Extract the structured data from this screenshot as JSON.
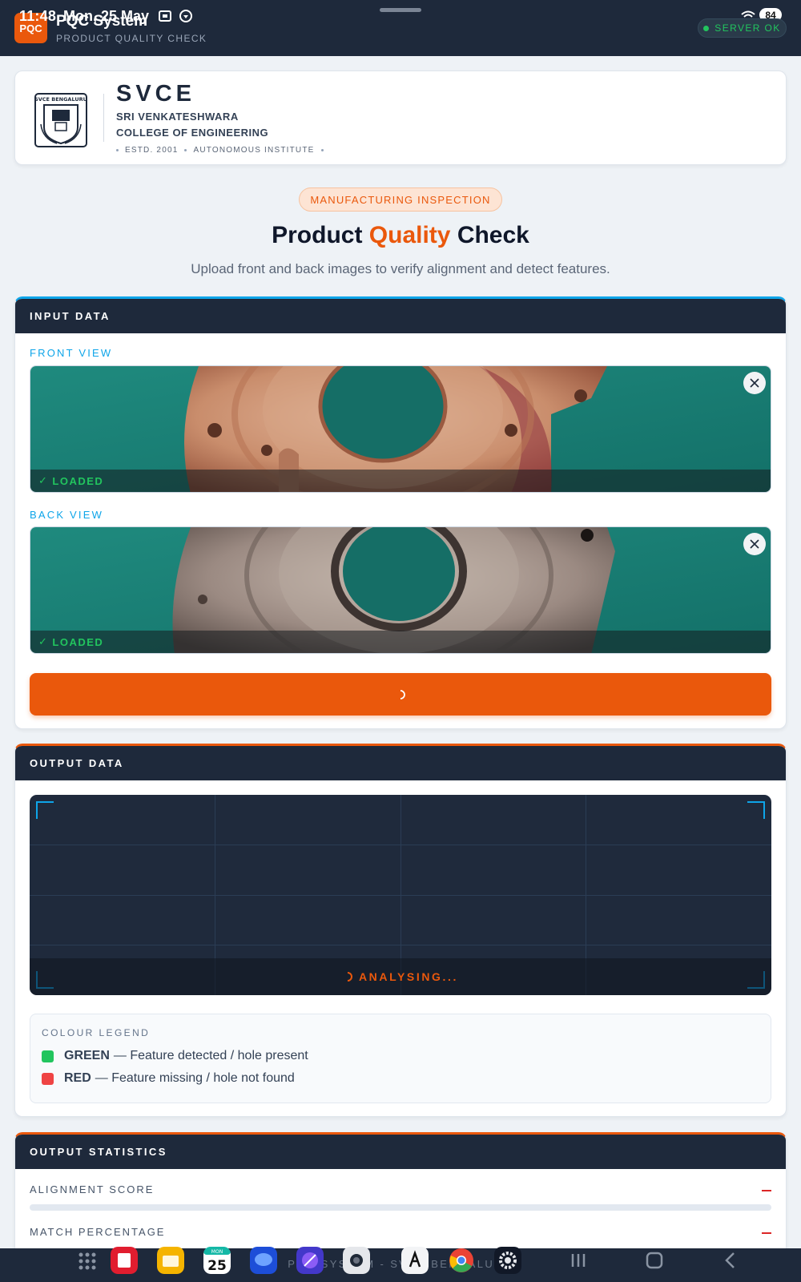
{
  "status_bar": {
    "time": "11:48",
    "date": "Mon, 25 May",
    "battery": "84"
  },
  "header": {
    "logo_text": "PQC",
    "title": "PQC System",
    "subtitle": "PRODUCT QUALITY CHECK",
    "server_status": "SERVER OK"
  },
  "college": {
    "seal_text": "SVCE BENGALURU",
    "short_name": "SVCE",
    "full_name_line1": "SRI VENKATESHWARA",
    "full_name_line2": "COLLEGE OF ENGINEERING",
    "established": "ESTD. 2001",
    "status": "AUTONOMOUS INSTITUTE"
  },
  "hero": {
    "tag": "MANUFACTURING INSPECTION",
    "title_pre": "Product ",
    "title_accent": "Quality",
    "title_post": " Check",
    "subtitle": "Upload front and back images to verify alignment and detect features."
  },
  "input_panel": {
    "heading": "INPUT DATA",
    "front_label": "FRONT VIEW",
    "back_label": "BACK VIEW",
    "front_status": "LOADED",
    "back_status": "LOADED"
  },
  "output_panel": {
    "heading": "OUTPUT DATA",
    "status": "ANALYSING...",
    "legend_title": "COLOUR LEGEND",
    "legend": [
      {
        "key": "GREEN",
        "desc": "— Feature detected / hole present",
        "color": "#22c55e"
      },
      {
        "key": "RED",
        "desc": "— Feature missing / hole not found",
        "color": "#ef4444"
      }
    ]
  },
  "stats_panel": {
    "heading": "OUTPUT STATISTICS",
    "rows": [
      {
        "label": "ALIGNMENT SCORE",
        "value": "—"
      },
      {
        "label": "MATCH PERCENTAGE",
        "value": "—"
      }
    ]
  },
  "footer": {
    "text": "PQC SYSTEM - SVCE BENGALURU"
  },
  "dock": {
    "calendar_day": "MON",
    "calendar_date": "25"
  },
  "colors": {
    "accent": "#ea580c",
    "navy": "#1e293b",
    "info": "#0ea5e9",
    "ok": "#22c55e",
    "error": "#ef4444"
  }
}
